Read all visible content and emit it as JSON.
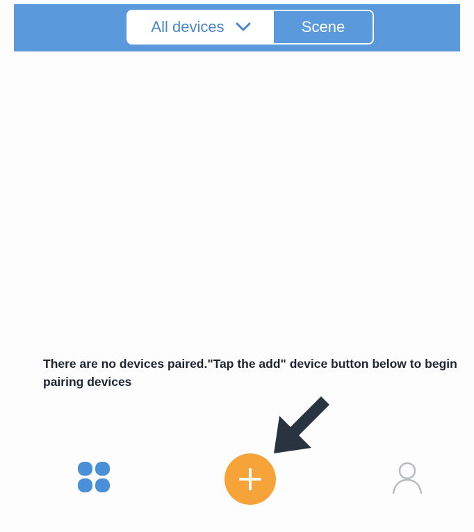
{
  "header": {
    "tabs": [
      {
        "label": "All devices",
        "selected": true,
        "has_dropdown": true
      },
      {
        "label": "Scene",
        "selected": false
      }
    ]
  },
  "empty_state": {
    "message": "There are no devices paired.\"Tap the add\" device button below to begin pairing devices"
  },
  "bottom_nav": {
    "items": [
      {
        "icon": "devices-grid-icon"
      },
      {
        "icon": "add-plus-icon"
      },
      {
        "icon": "user-profile-icon"
      }
    ]
  },
  "colors": {
    "header_blue": "#5a99dc",
    "add_button_orange": "#f6a33a",
    "devices_icon_blue": "#4a90d9",
    "arrow": "#2a3440",
    "profile_icon_gray": "#b8bcc2"
  }
}
